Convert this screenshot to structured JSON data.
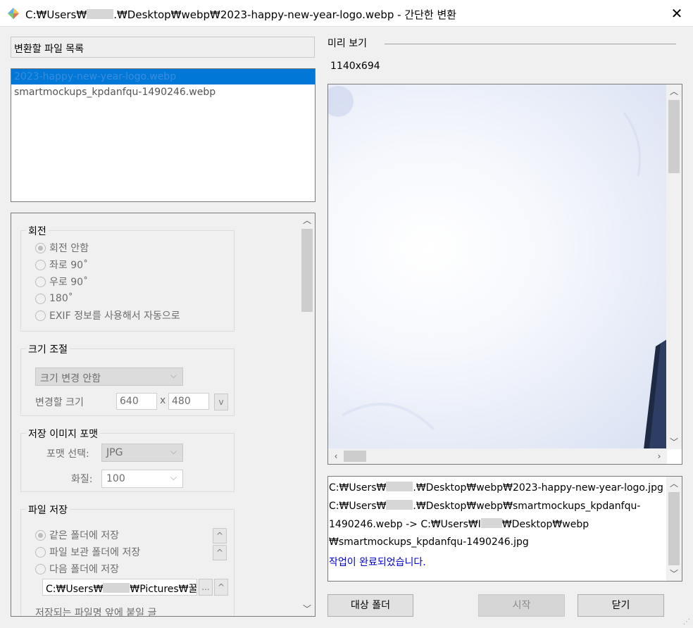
{
  "window": {
    "title_prefix": "C:₩Users₩",
    "title_suffix": ".₩Desktop₩webp₩2023-happy-new-year-logo.webp - 간단한 변환",
    "close_glyph": "✕"
  },
  "file_list": {
    "header": "변환할 파일 목록",
    "items": [
      "2023-happy-new-year-logo.webp",
      "smartmockups_kpdanfqu-1490246.webp"
    ]
  },
  "rotation": {
    "legend": "회전",
    "options": [
      "회전 안함",
      "좌로 90˚",
      "우로 90˚",
      "180˚",
      "EXIF 정보를 사용해서 자동으로"
    ],
    "selected": "회전 안함"
  },
  "resize": {
    "legend": "크기 조절",
    "mode": "크기 변경 안함",
    "size_label": "변경할 크기",
    "width": "640",
    "x_sep": "x",
    "height": "480",
    "preset_button": "v"
  },
  "format": {
    "legend": "저장 이미지 포맷",
    "format_label": "포맷 선택:",
    "format_value": "JPG",
    "quality_label": "화질:",
    "quality_value": "100"
  },
  "save": {
    "legend": "파일 저장",
    "options": [
      "같은 폴더에 저장",
      "파일 보관 폴더에 저장",
      "다음 폴더에 저장"
    ],
    "selected": "같은 폴더에 저장",
    "folder_prefix": "C:₩Users₩",
    "folder_suffix": "₩Pictures₩꿀뷰",
    "browse": "...",
    "up_glyph": "^",
    "prefix_label": "저장되는 파일명 앞에 붙일 글"
  },
  "preview": {
    "label": "미리 보기",
    "dimensions": "1140x694"
  },
  "log": {
    "line1_prefix": "C:₩Users₩",
    "line1_suffix": ".₩Desktop₩webp₩2023-happy-new-year-logo.jpg",
    "line2_prefix": "C:₩Users₩",
    "line2_suffix": ".₩Desktop₩webp₩smartmockups_kpdanfqu-",
    "line3_prefix": "1490246.webp -> C:₩Users₩I",
    "line3_suffix": "₩Desktop₩webp",
    "line4": "₩smartmockups_kpdanfqu-1490246.jpg",
    "done": "작업이 완료되었습니다."
  },
  "buttons": {
    "target_folder": "대상 폴더",
    "start": "시작",
    "close": "닫기"
  },
  "colors": {
    "selection": "#0078d7",
    "done_text": "#0000cc"
  }
}
